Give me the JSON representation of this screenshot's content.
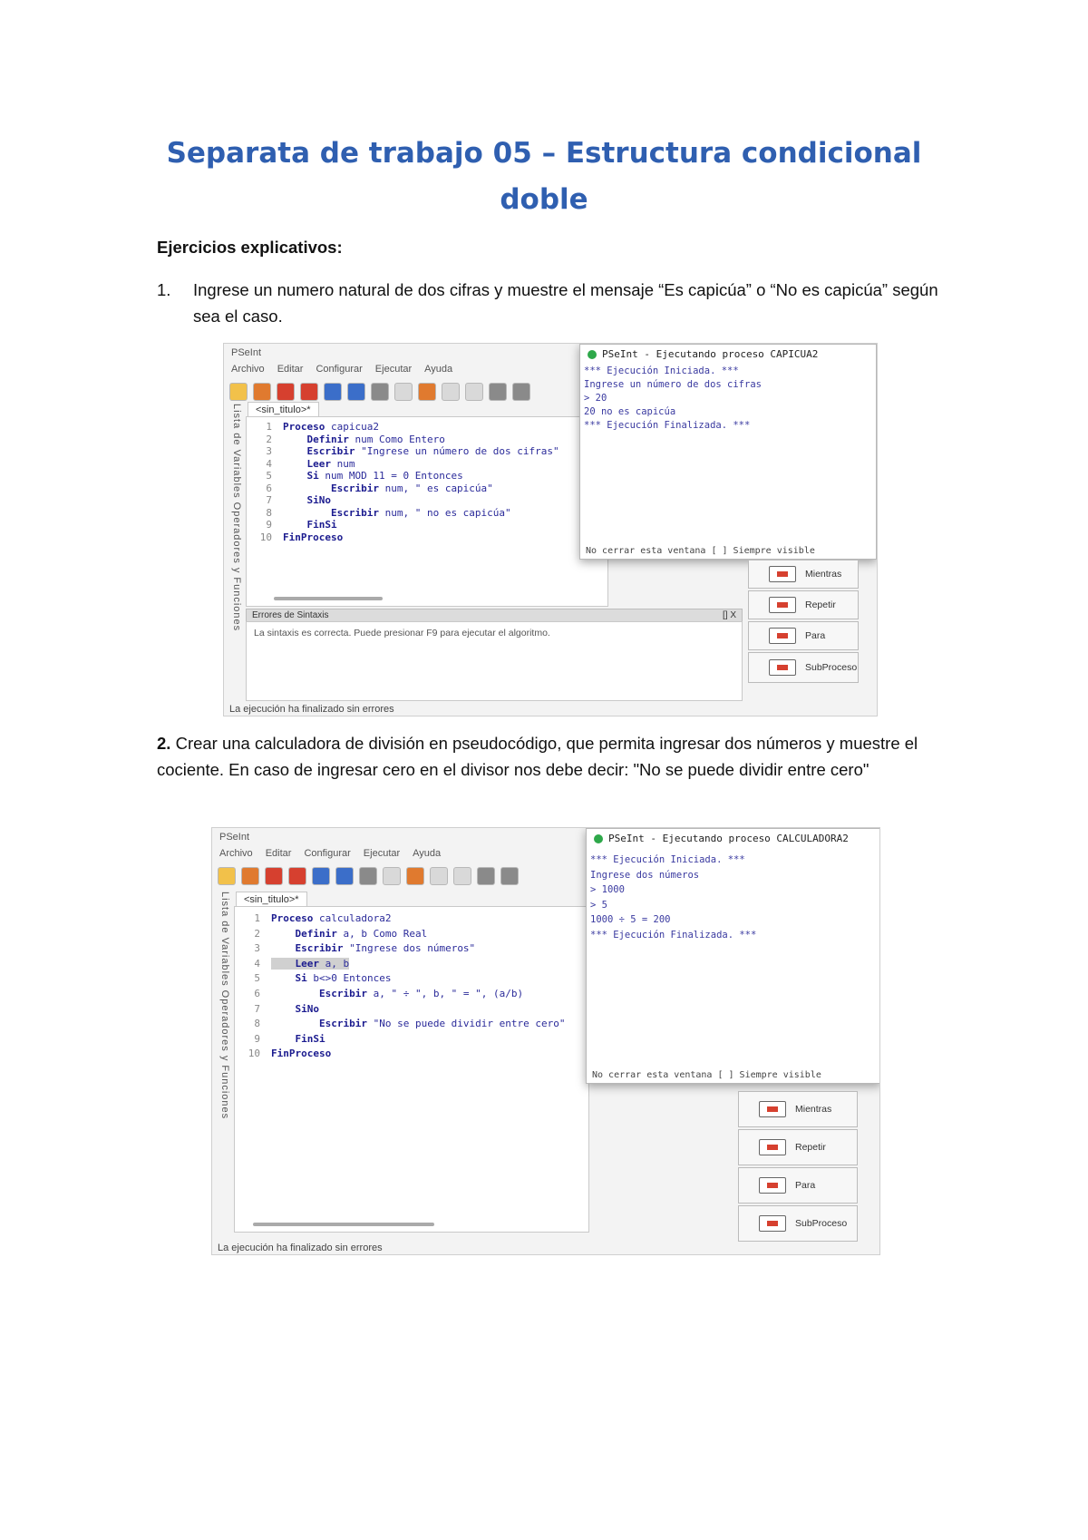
{
  "document": {
    "title": "Separata de trabajo 05 – Estructura condicional doble",
    "section_heading": "Ejercicios explicativos:",
    "exercise1": {
      "number": "1.",
      "text": "Ingrese un numero natural de dos cifras y muestre el mensaje “Es capicúa” o “No es capicúa” según sea el caso."
    },
    "exercise2": {
      "number": "2.",
      "text": "Crear una calculadora de división en pseudocódigo, que permita ingresar dos números y muestre el cociente. En caso de ingresar cero en el divisor nos debe decir: \"No se puede dividir entre cero\""
    }
  },
  "shared": {
    "app_title": "PSeInt",
    "menu": [
      "Archivo",
      "Editar",
      "Configurar",
      "Ejecutar",
      "Ayuda"
    ],
    "file_tab": "<sin_titulo>*",
    "side_tabs": "Lista de Variables  Operadores y Funciones",
    "run_footer": "No cerrar esta ventana  [ ] Siempre visible",
    "commands": [
      "Mientras",
      "Repetir",
      "Para",
      "SubProceso"
    ],
    "status": "La ejecución ha finalizado sin errores"
  },
  "shot1": {
    "run_title": "PSeInt - Ejecutando proceso CAPICUA2",
    "code": [
      {
        "n": "1",
        "kw": "Proceso",
        "rest": " capicua2"
      },
      {
        "n": "2",
        "kw": "    Definir",
        "rest": " num Como Entero"
      },
      {
        "n": "3",
        "kw": "    Escribir",
        "rest": " \"Ingrese un número de dos cifras\""
      },
      {
        "n": "4",
        "kw": "    Leer",
        "rest": " num"
      },
      {
        "n": "5",
        "kw": "    Si",
        "rest": " num MOD 11 = 0 Entonces"
      },
      {
        "n": "6",
        "kw": "        Escribir",
        "rest": " num, \" es capicúa\""
      },
      {
        "n": "7",
        "kw": "    SiNo",
        "rest": ""
      },
      {
        "n": "8",
        "kw": "        Escribir",
        "rest": " num, \" no es capicúa\""
      },
      {
        "n": "9",
        "kw": "    FinSi",
        "rest": ""
      },
      {
        "n": "10",
        "kw": "FinProceso",
        "rest": ""
      }
    ],
    "output": [
      "*** Ejecución Iniciada. ***",
      "Ingrese un número de dos cifras",
      "> 20",
      "20 no es capicúa",
      "*** Ejecución Finalizada. ***"
    ],
    "errors_title": "Errores de Sintaxis",
    "errors_buttons": "[] X",
    "errors_text": "La sintaxis es correcta. Puede presionar F9 para ejecutar el algoritmo."
  },
  "shot2": {
    "run_title": "PSeInt - Ejecutando proceso CALCULADORA2",
    "code": [
      {
        "n": "1",
        "kw": "Proceso",
        "rest": " calculadora2"
      },
      {
        "n": "2",
        "kw": "    Definir",
        "rest": " a, b Como Real"
      },
      {
        "n": "3",
        "kw": "    Escribir",
        "rest": " \"Ingrese dos números\""
      },
      {
        "n": "4",
        "kw": "    Leer",
        "rest": " a, b"
      },
      {
        "n": "5",
        "kw": "    Si",
        "rest": " b<>0 Entonces"
      },
      {
        "n": "6",
        "kw": "        Escribir",
        "rest": " a, \" ÷ \", b, \" = \", (a/b)"
      },
      {
        "n": "7",
        "kw": "    SiNo",
        "rest": ""
      },
      {
        "n": "8",
        "kw": "        Escribir",
        "rest": " \"No se puede dividir entre cero\""
      },
      {
        "n": "9",
        "kw": "    FinSi",
        "rest": ""
      },
      {
        "n": "10",
        "kw": "FinProceso",
        "rest": ""
      }
    ],
    "output": [
      "*** Ejecución Iniciada. ***",
      "Ingrese dos números",
      "> 1000",
      "> 5",
      "1000 ÷ 5 = 200",
      "*** Ejecución Finalizada. ***"
    ]
  }
}
